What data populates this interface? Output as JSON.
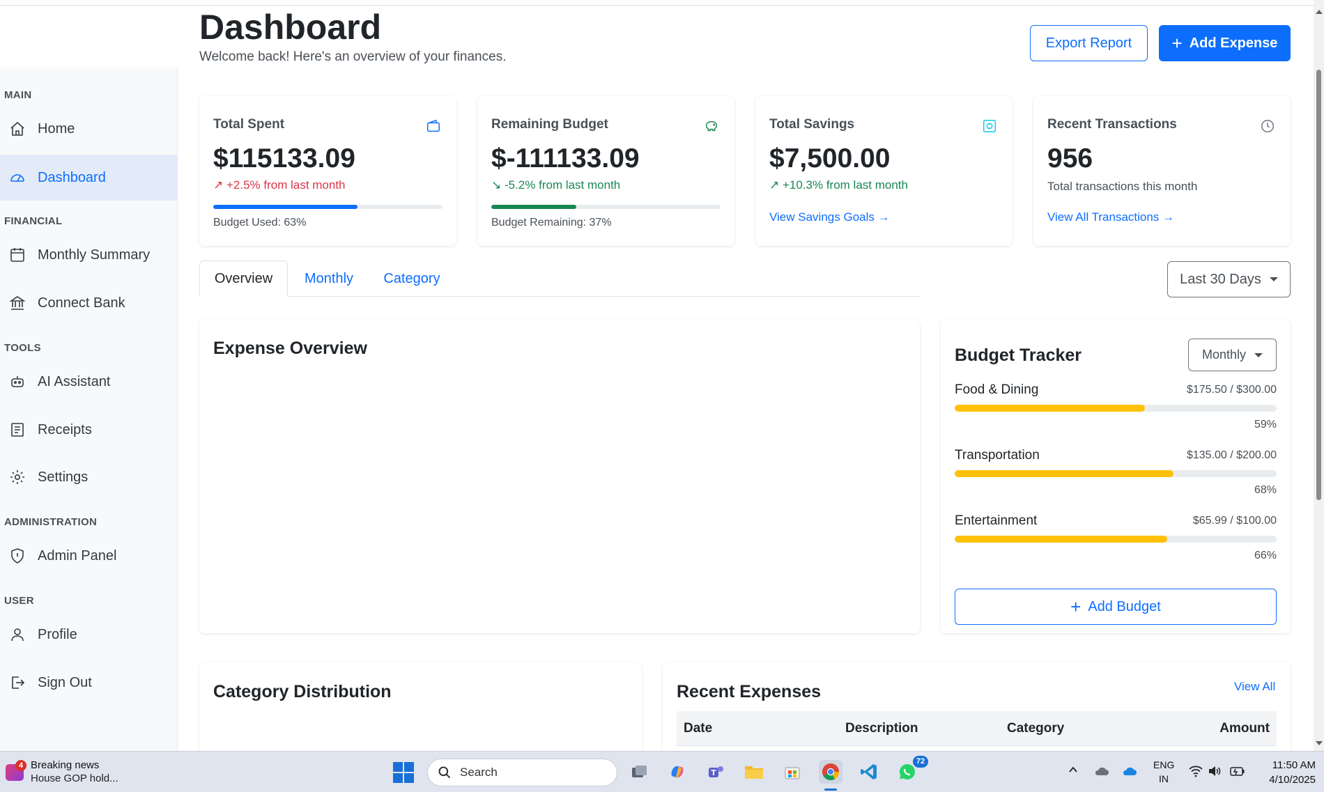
{
  "header": {
    "title": "Dashboard",
    "subtitle": "Welcome back! Here's an overview of your finances.",
    "export_label": "Export Report",
    "add_expense_label": "Add Expense"
  },
  "sidebar": {
    "sections": [
      {
        "title": "MAIN",
        "items": [
          {
            "label": "Home",
            "icon": "home-icon"
          },
          {
            "label": "Dashboard",
            "icon": "gauge-icon",
            "active": true
          }
        ]
      },
      {
        "title": "FINANCIAL",
        "items": [
          {
            "label": "Monthly Summary",
            "icon": "calendar-icon"
          },
          {
            "label": "Connect Bank",
            "icon": "bank-icon"
          }
        ]
      },
      {
        "title": "TOOLS",
        "items": [
          {
            "label": "AI Assistant",
            "icon": "robot-icon"
          },
          {
            "label": "Receipts",
            "icon": "receipt-icon"
          },
          {
            "label": "Settings",
            "icon": "gear-icon"
          }
        ]
      },
      {
        "title": "ADMINISTRATION",
        "items": [
          {
            "label": "Admin Panel",
            "icon": "shield-icon"
          }
        ]
      },
      {
        "title": "USER",
        "items": [
          {
            "label": "Profile",
            "icon": "person-icon"
          },
          {
            "label": "Sign Out",
            "icon": "sign-out-icon"
          }
        ]
      }
    ]
  },
  "stats": {
    "total_spent": {
      "label": "Total Spent",
      "value": "$115133.09",
      "change": "↗ +2.5% from last month",
      "progress": 0.63,
      "note": "Budget Used: 63%"
    },
    "remaining": {
      "label": "Remaining Budget",
      "value": "$-111133.09",
      "change": "↘ -5.2% from last month",
      "progress": 0.37,
      "note": "Budget Remaining: 37%"
    },
    "savings": {
      "label": "Total Savings",
      "value": "$7,500.00",
      "change": "↗ +10.3% from last month",
      "link": "View Savings Goals →"
    },
    "transactions": {
      "label": "Recent Transactions",
      "value": "956",
      "sub": "Total transactions this month",
      "link": "View All Transactions →"
    }
  },
  "tabs": [
    "Overview",
    "Monthly",
    "Category"
  ],
  "range_dropdown": "Last 30 Days",
  "expense_overview": {
    "title": "Expense Overview"
  },
  "budget_tracker": {
    "title": "Budget Tracker",
    "period": "Monthly",
    "items": [
      {
        "name": "Food & Dining",
        "amount": "$175.50 / $300.00",
        "percent": "59%",
        "progress": 0.59
      },
      {
        "name": "Transportation",
        "amount": "$135.00 / $200.00",
        "percent": "68%",
        "progress": 0.68
      },
      {
        "name": "Entertainment",
        "amount": "$65.99 / $100.00",
        "percent": "66%",
        "progress": 0.66
      }
    ],
    "add_label": "Add Budget"
  },
  "category_distribution": {
    "title": "Category Distribution"
  },
  "recent_expenses": {
    "title": "Recent Expenses",
    "view_all": "View All",
    "columns": [
      "Date",
      "Description",
      "Category",
      "Amount"
    ]
  },
  "colors": {
    "primary": "#0d6efd",
    "success": "#198754",
    "danger": "#dc3545",
    "warning": "#ffc107"
  },
  "taskbar": {
    "news_badge": "4",
    "news_title": "Breaking news",
    "news_text": "House GOP hold...",
    "search_placeholder": "Search",
    "whatsapp_badge": "72",
    "lang_line1": "ENG",
    "lang_line2": "IN",
    "time": "11:50 AM",
    "date": "4/10/2025"
  }
}
